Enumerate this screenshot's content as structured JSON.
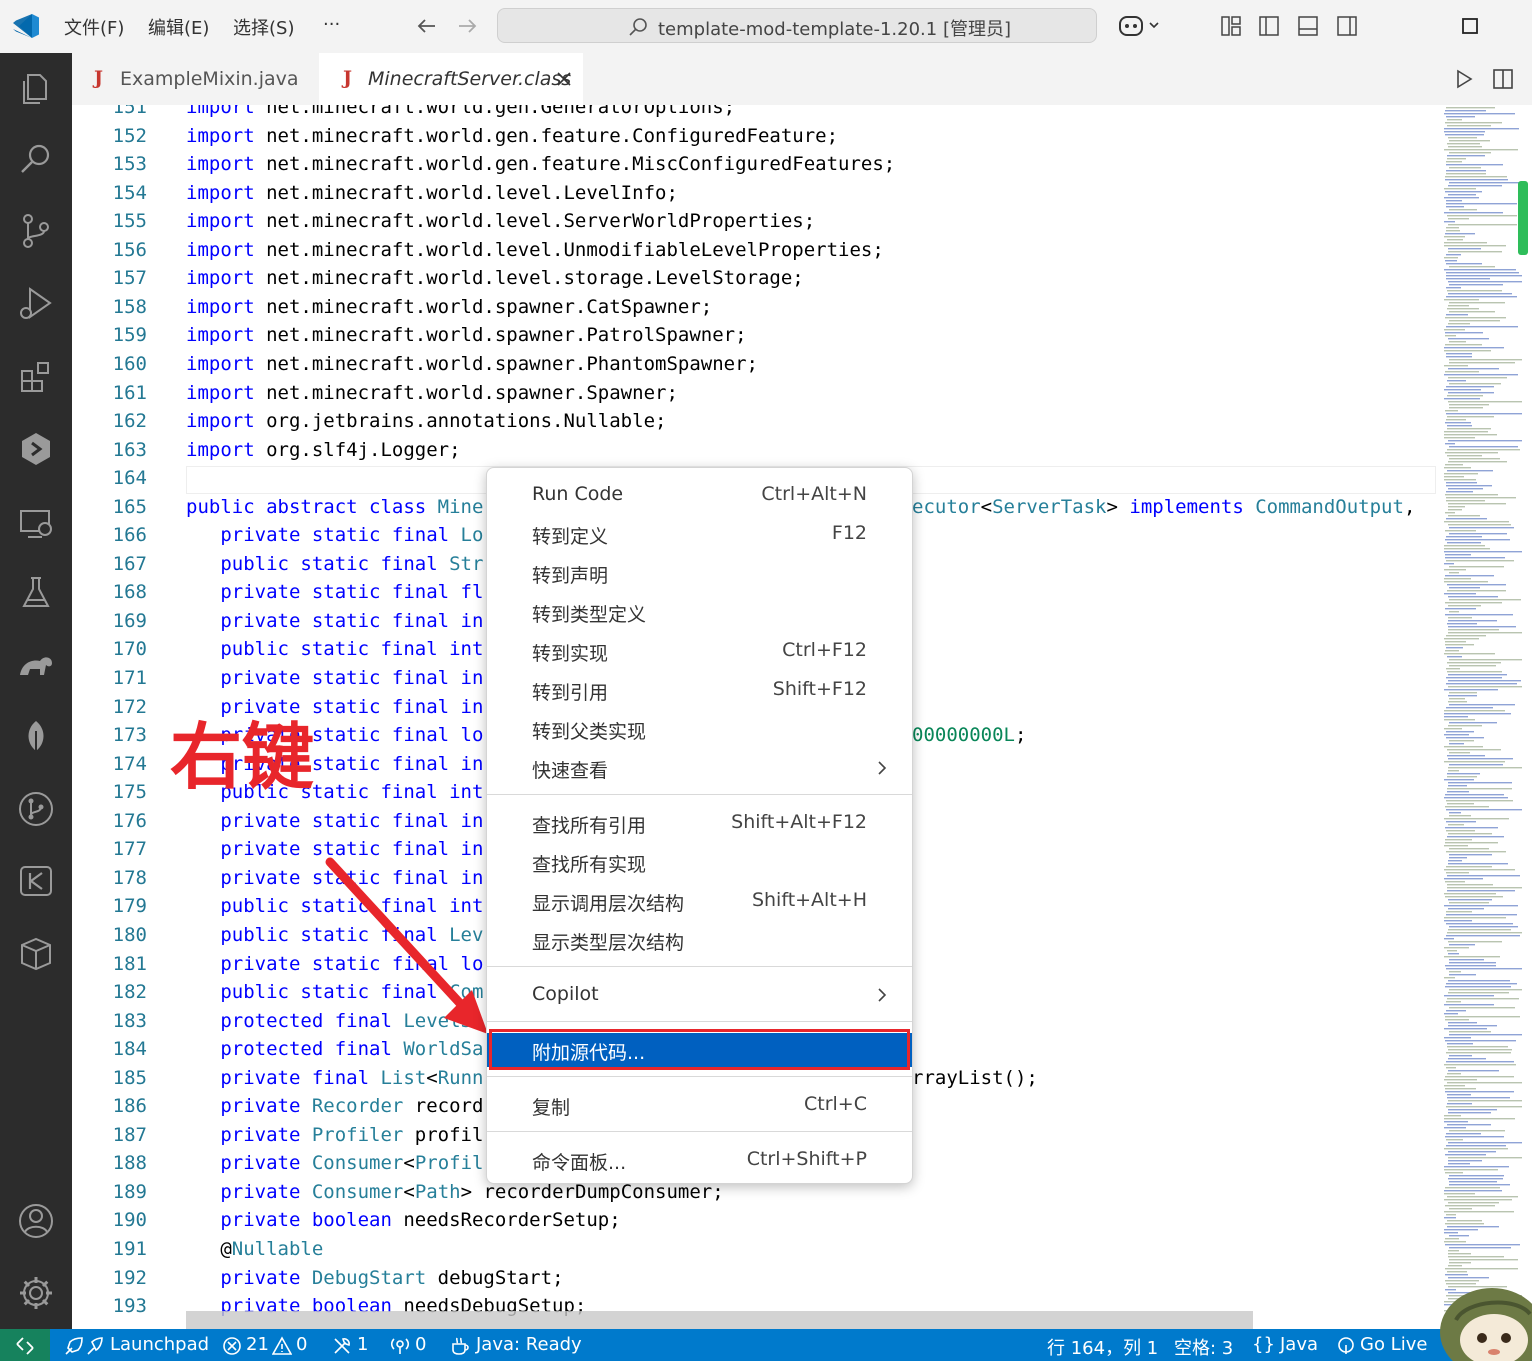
{
  "titlebar": {
    "menus": [
      "文件(F)",
      "编辑(E)",
      "选择(S)",
      "···"
    ],
    "search_text": "template-mod-template-1.20.1 [管理员]"
  },
  "tabs": [
    {
      "icon": "J",
      "label": "ExampleMixin.java",
      "active": false
    },
    {
      "icon": "J",
      "label": "MinecraftServer.class",
      "active": true
    }
  ],
  "editor": {
    "lines": [
      {
        "n": "151",
        "t": [
          [
            "kw",
            "import"
          ],
          [
            "",
            "net.minecraft.world.gen.GeneratorOptions;"
          ]
        ]
      },
      {
        "n": "152",
        "t": [
          [
            "kw",
            "import"
          ],
          [
            "",
            "net.minecraft.world.gen.feature.ConfiguredFeature;"
          ]
        ]
      },
      {
        "n": "153",
        "t": [
          [
            "kw",
            "import"
          ],
          [
            "",
            "net.minecraft.world.gen.feature.MiscConfiguredFeatures;"
          ]
        ]
      },
      {
        "n": "154",
        "t": [
          [
            "kw",
            "import"
          ],
          [
            "",
            "net.minecraft.world.level.LevelInfo;"
          ]
        ]
      },
      {
        "n": "155",
        "t": [
          [
            "kw",
            "import"
          ],
          [
            "",
            "net.minecraft.world.level.ServerWorldProperties;"
          ]
        ]
      },
      {
        "n": "156",
        "t": [
          [
            "kw",
            "import"
          ],
          [
            "",
            "net.minecraft.world.level.UnmodifiableLevelProperties;"
          ]
        ]
      },
      {
        "n": "157",
        "t": [
          [
            "kw",
            "import"
          ],
          [
            "",
            "net.minecraft.world.level.storage.LevelStorage;"
          ]
        ]
      },
      {
        "n": "158",
        "t": [
          [
            "kw",
            "import"
          ],
          [
            "",
            "net.minecraft.world.spawner.CatSpawner;"
          ]
        ]
      },
      {
        "n": "159",
        "t": [
          [
            "kw",
            "import"
          ],
          [
            "",
            "net.minecraft.world.spawner.PatrolSpawner;"
          ]
        ]
      },
      {
        "n": "160",
        "t": [
          [
            "kw",
            "import"
          ],
          [
            "",
            "net.minecraft.world.spawner.PhantomSpawner;"
          ]
        ]
      },
      {
        "n": "161",
        "t": [
          [
            "kw",
            "import"
          ],
          [
            "",
            "net.minecraft.world.spawner.Spawner;"
          ]
        ]
      },
      {
        "n": "162",
        "t": [
          [
            "kw",
            "import"
          ],
          [
            "",
            "org.jetbrains.annotations.Nullable;"
          ]
        ]
      },
      {
        "n": "163",
        "t": [
          [
            "kw",
            "import"
          ],
          [
            "",
            "org.slf4j.Logger;"
          ]
        ]
      },
      {
        "n": "164",
        "t": []
      },
      {
        "n": "165",
        "t": [
          [
            "kw",
            "public abstract class "
          ],
          [
            "ty",
            "Mine"
          ]
        ]
      },
      {
        "n": "166",
        "t": [
          [
            "kw",
            "   private static final "
          ],
          [
            "ty",
            "Lo"
          ]
        ]
      },
      {
        "n": "167",
        "t": [
          [
            "kw",
            "   public static final "
          ],
          [
            "ty",
            "Str"
          ]
        ]
      },
      {
        "n": "168",
        "t": [
          [
            "kw",
            "   private static final fl"
          ]
        ]
      },
      {
        "n": "169",
        "t": [
          [
            "kw",
            "   private static final in"
          ]
        ]
      },
      {
        "n": "170",
        "t": [
          [
            "kw",
            "   public static final int"
          ]
        ]
      },
      {
        "n": "171",
        "t": [
          [
            "kw",
            "   private static final in"
          ]
        ]
      },
      {
        "n": "172",
        "t": [
          [
            "kw",
            "   private static final in"
          ]
        ]
      },
      {
        "n": "173",
        "t": [
          [
            "kw",
            "   private static final lo"
          ]
        ]
      },
      {
        "n": "174",
        "t": [
          [
            "kw",
            "   private static final in"
          ]
        ]
      },
      {
        "n": "175",
        "t": [
          [
            "kw",
            "   public static final int"
          ]
        ]
      },
      {
        "n": "176",
        "t": [
          [
            "kw",
            "   private static final in"
          ]
        ]
      },
      {
        "n": "177",
        "t": [
          [
            "kw",
            "   private static final in"
          ]
        ]
      },
      {
        "n": "178",
        "t": [
          [
            "kw",
            "   private static final in"
          ]
        ]
      },
      {
        "n": "179",
        "t": [
          [
            "kw",
            "   public static final int"
          ]
        ]
      },
      {
        "n": "180",
        "t": [
          [
            "kw",
            "   public static final "
          ],
          [
            "ty",
            "Lev"
          ]
        ]
      },
      {
        "n": "181",
        "t": [
          [
            "kw",
            "   private static final lo"
          ]
        ]
      },
      {
        "n": "182",
        "t": [
          [
            "kw",
            "   public static final "
          ],
          [
            "ty",
            "Com"
          ]
        ]
      },
      {
        "n": "183",
        "t": [
          [
            "kw",
            "   protected final "
          ],
          [
            "ty",
            "LevelS"
          ]
        ]
      },
      {
        "n": "184",
        "t": [
          [
            "kw",
            "   protected final "
          ],
          [
            "ty",
            "WorldSa"
          ]
        ]
      },
      {
        "n": "185",
        "t": [
          [
            "kw",
            "   private final "
          ],
          [
            "ty",
            "List"
          ],
          [
            "",
            "<"
          ],
          [
            "ty",
            "Runn"
          ]
        ]
      },
      {
        "n": "186",
        "t": [
          [
            "kw",
            "   private "
          ],
          [
            "ty",
            "Recorder"
          ],
          [
            "",
            " record"
          ]
        ]
      },
      {
        "n": "187",
        "t": [
          [
            "kw",
            "   private "
          ],
          [
            "ty",
            "Profiler"
          ],
          [
            "",
            " profil"
          ]
        ]
      },
      {
        "n": "188",
        "t": [
          [
            "kw",
            "   private "
          ],
          [
            "ty",
            "Consumer"
          ],
          [
            "",
            "<"
          ],
          [
            "ty",
            "Profil"
          ]
        ]
      },
      {
        "n": "189",
        "t": [
          [
            "kw",
            "   private "
          ],
          [
            "ty",
            "Consumer"
          ],
          [
            "",
            "<"
          ],
          [
            "ty",
            "Path"
          ],
          [
            "",
            "> recorderDumpConsumer;"
          ]
        ]
      },
      {
        "n": "190",
        "t": [
          [
            "kw",
            "   private boolean "
          ],
          [
            "",
            "needsRecorderSetup;"
          ]
        ]
      },
      {
        "n": "191",
        "t": [
          [
            "",
            "   @"
          ],
          [
            "an",
            "Nullable"
          ]
        ]
      },
      {
        "n": "192",
        "t": [
          [
            "kw",
            "   private "
          ],
          [
            "ty",
            "DebugStart"
          ],
          [
            "",
            " debugStart;"
          ]
        ]
      },
      {
        "n": "193",
        "t": [
          [
            "kw",
            "   private boolean "
          ],
          [
            "",
            "needsDebugSetup;"
          ]
        ]
      }
    ],
    "right_fragments": [
      {
        "line": "165",
        "t": [
          [
            "ty",
            "ecutor"
          ],
          [
            "",
            "<"
          ],
          [
            "ty",
            "ServerTask"
          ],
          [
            "",
            "> "
          ],
          [
            "kw",
            "implements "
          ],
          [
            "ty",
            "CommandOutput"
          ],
          [
            "",
            ",  A"
          ]
        ]
      },
      {
        "line": "173",
        "t": [
          [
            "nu",
            "00000000L"
          ],
          [
            "",
            ";"
          ]
        ]
      },
      {
        "line": "185",
        "t": [
          [
            "",
            "rrayList();"
          ]
        ]
      }
    ]
  },
  "context_menu": {
    "items": [
      {
        "label": "Run Code",
        "shortcut": "Ctrl+Alt+N"
      },
      {
        "label": "转到定义",
        "shortcut": "F12"
      },
      {
        "label": "转到声明",
        "shortcut": ""
      },
      {
        "label": "转到类型定义",
        "shortcut": ""
      },
      {
        "label": "转到实现",
        "shortcut": "Ctrl+F12"
      },
      {
        "label": "转到引用",
        "shortcut": "Shift+F12"
      },
      {
        "label": "转到父类实现",
        "shortcut": ""
      },
      {
        "label": "快速查看",
        "shortcut": ""
      },
      {
        "label": "查找所有引用",
        "shortcut": "Shift+Alt+F12"
      },
      {
        "label": "查找所有实现",
        "shortcut": ""
      },
      {
        "label": "显示调用层次结构",
        "shortcut": "Shift+Alt+H"
      },
      {
        "label": "显示类型层次结构",
        "shortcut": ""
      },
      {
        "label": "Copilot",
        "shortcut": ""
      },
      {
        "label": "附加源代码...",
        "shortcut": ""
      },
      {
        "label": "复制",
        "shortcut": "Ctrl+C"
      },
      {
        "label": "命令面板...",
        "shortcut": "Ctrl+Shift+P"
      }
    ]
  },
  "annotation": {
    "text": "右键"
  },
  "statusbar": {
    "launchpad": "Launchpad",
    "errors": "21",
    "warnings": "0",
    "tools": "1",
    "ports": "0",
    "java_status": "Java: Ready",
    "position": "行 164，列 1",
    "spaces": "空格: 3",
    "language": "Java",
    "golive": "Go Live"
  },
  "colors": {
    "activitybar": "#2c2c2c",
    "statusbar": "#007acc",
    "selection": "#0060c0",
    "annotation_red": "#e8262b",
    "keyword": "#0000ff",
    "type": "#267f99"
  }
}
